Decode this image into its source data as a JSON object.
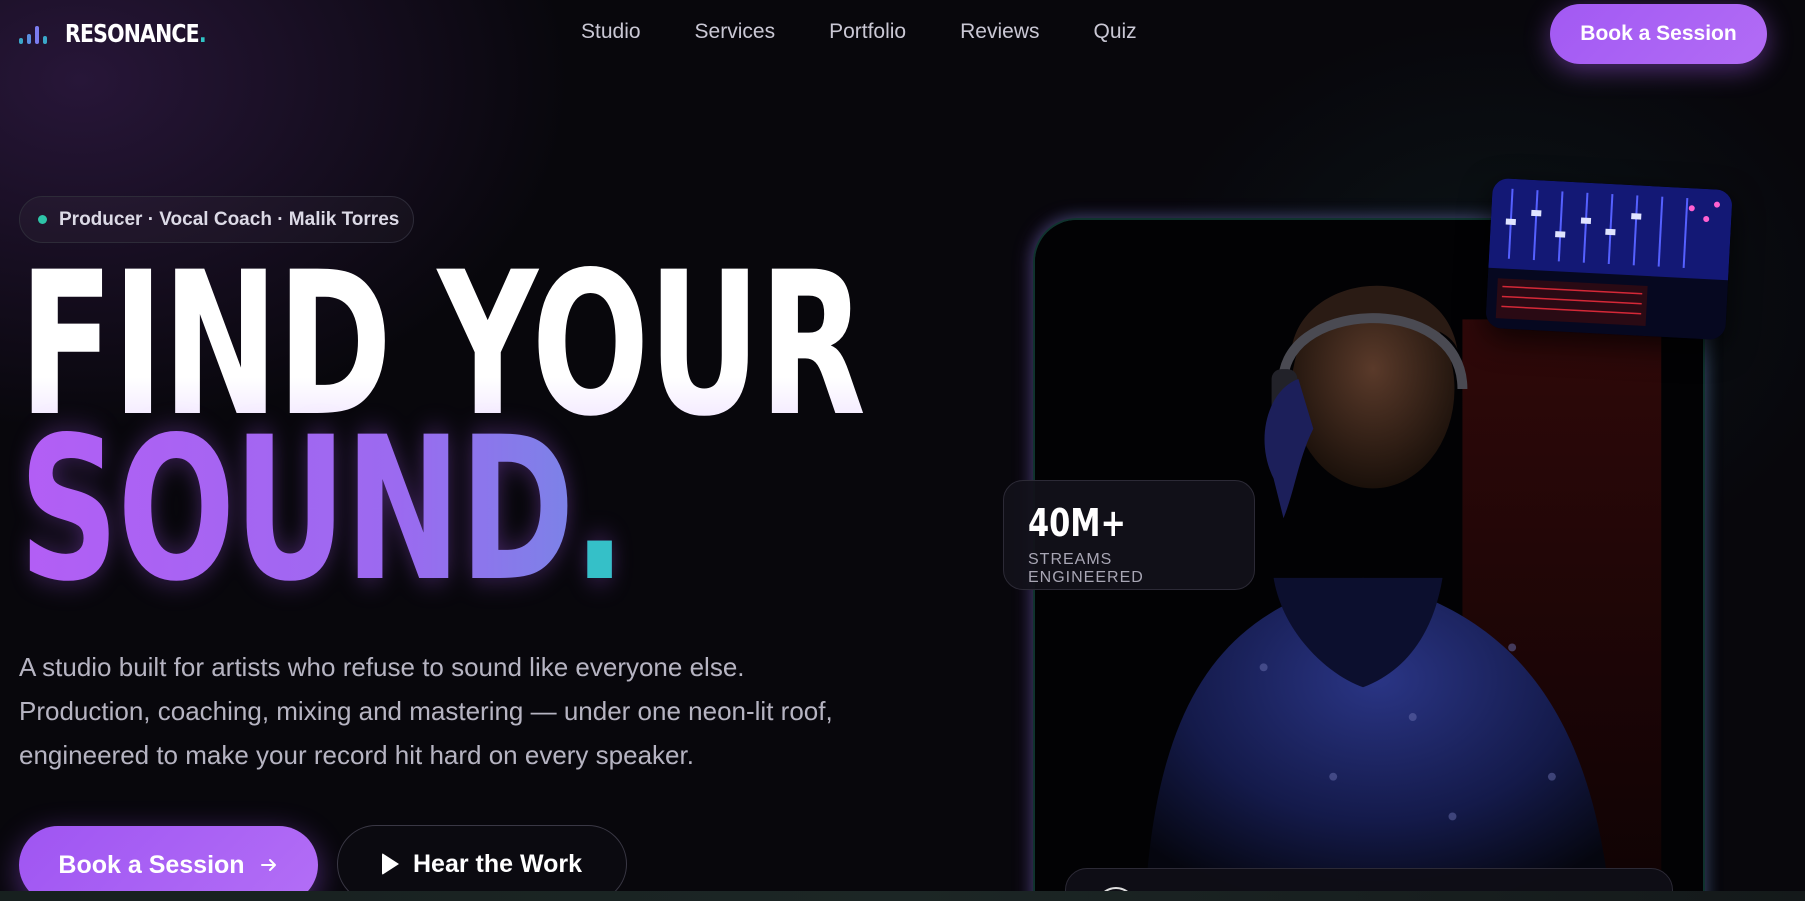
{
  "brand": {
    "name": "RESONANCE",
    "dot": "."
  },
  "nav": {
    "links": [
      "Studio",
      "Services",
      "Portfolio",
      "Reviews",
      "Quiz"
    ],
    "cta": "Book a Session"
  },
  "hero": {
    "eyebrow": "Producer · Vocal Coach · Malik Torres",
    "headline_line1": "FIND YOUR",
    "headline_line2": "SOUND",
    "headline_dot": ".",
    "lead": "A studio built for artists who refuse to sound like everyone else. Production, coaching, mixing and mastering — under one neon-lit roof, engineered to make your record hit hard on every speaker.",
    "primary_cta": "Book a Session",
    "secondary_cta": "Hear the Work"
  },
  "stat": {
    "value": "40M+",
    "label": "STREAMS ENGINEERED"
  },
  "colors": {
    "background": "#08070c",
    "accent_purple": "#a259f3",
    "accent_teal": "#2fc4c6",
    "text_muted": "#b6b4c2"
  },
  "icons": {
    "logo": "equalizer-bars-icon",
    "primary_cta": "arrow-right-icon",
    "secondary_cta": "play-icon",
    "eyebrow": "status-dot-icon"
  }
}
